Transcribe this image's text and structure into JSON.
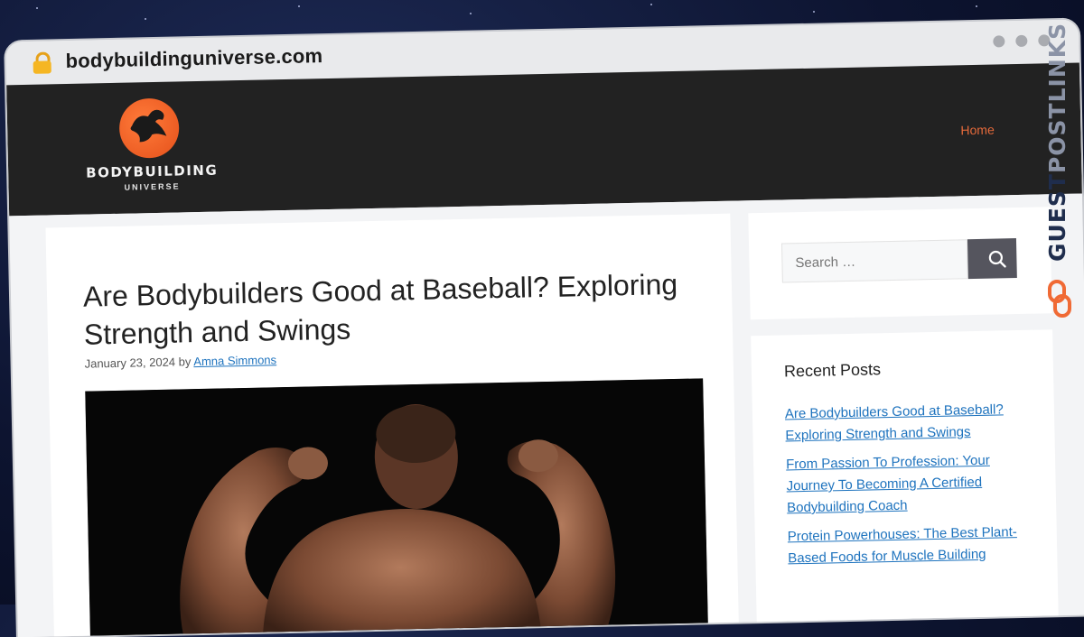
{
  "browser": {
    "url": "bodybuildinguniverse.com",
    "icons": {
      "lock": "lock-icon",
      "window_dots": "window-control-dots"
    }
  },
  "header": {
    "logo_word": "BODYBUILDING",
    "logo_sub": "UNIVERSE",
    "nav_home": "Home",
    "colors": {
      "header_bg": "#222222",
      "accent": "#e56a3b"
    }
  },
  "article": {
    "title": "Are Bodybuilders Good at Baseball? Exploring Strength and Swings",
    "date": "January 23, 2024",
    "by": "by",
    "author": "Amna Simmons",
    "image_alt_icon": "featured-image"
  },
  "sidebar": {
    "search_placeholder": "Search …",
    "search_icon": "search-icon",
    "recent_heading": "Recent Posts",
    "recent_posts": [
      "Are Bodybuilders Good at Baseball? Exploring Strength and Swings",
      "From Passion To Profession: Your Journey To Becoming A Certified Bodybuilding Coach",
      "Protein Powerhouses: The Best Plant-Based Foods for Muscle Building"
    ],
    "link_color": "#1e73be"
  },
  "watermark": {
    "part1": "GUEST",
    "part2": "POSTLINKS"
  }
}
